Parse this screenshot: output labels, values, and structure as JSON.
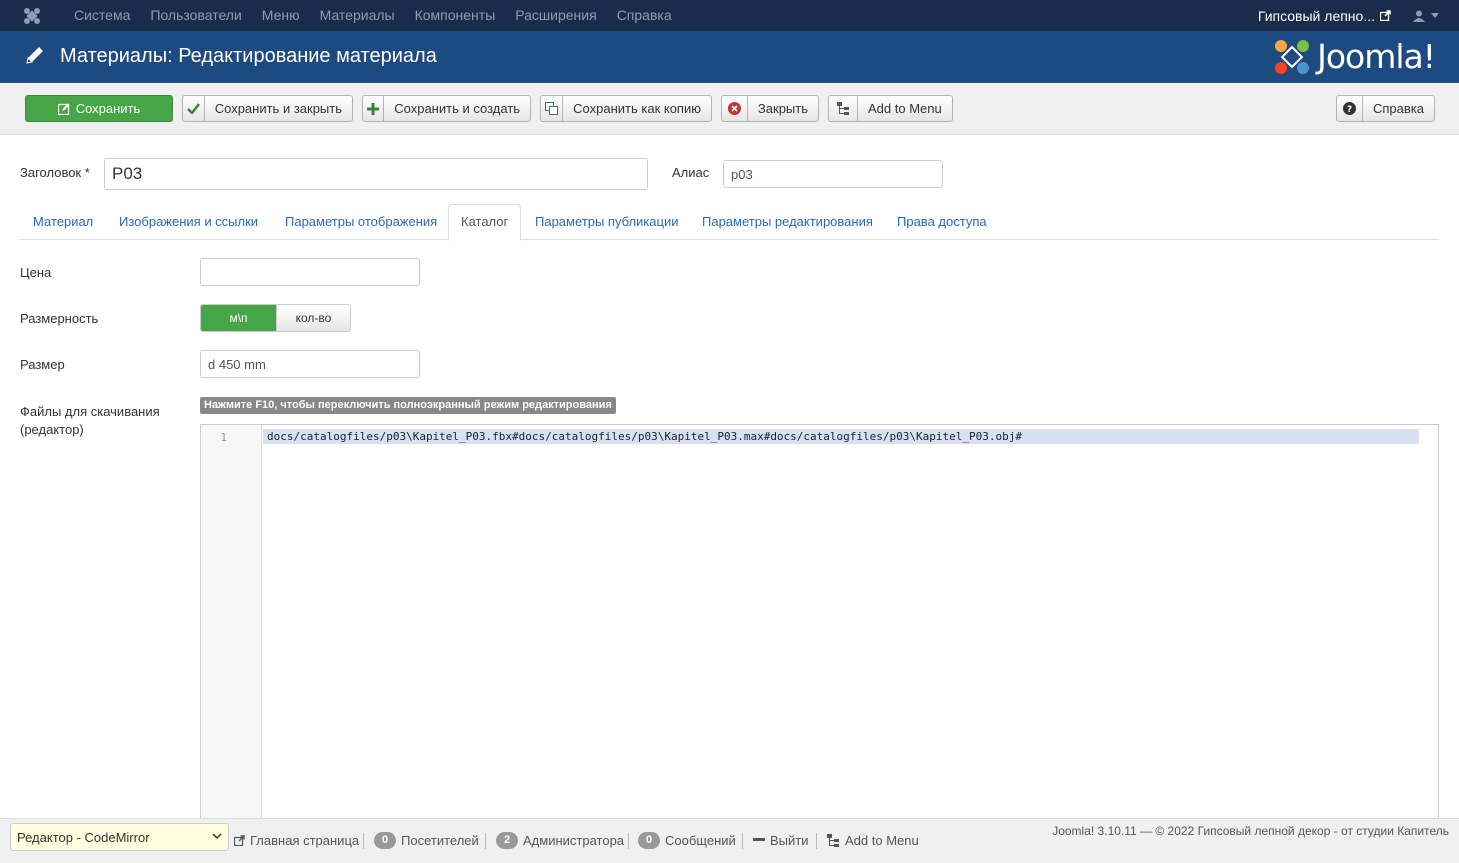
{
  "topnav": {
    "menu": [
      "Система",
      "Пользователи",
      "Меню",
      "Материалы",
      "Компоненты",
      "Расширения",
      "Справка"
    ],
    "site_name": "Гипсовый лепно..."
  },
  "header": {
    "title": "Материалы: Редактирование материала",
    "logo_text": "Joomla!"
  },
  "toolbar": {
    "save": "Сохранить",
    "save_close": "Сохранить и закрыть",
    "save_new": "Сохранить и создать",
    "save_copy": "Сохранить как копию",
    "close": "Закрыть",
    "add_to_menu": "Add to Menu",
    "help": "Справка"
  },
  "form": {
    "title_label": "Заголовок *",
    "title_value": "P03",
    "alias_label": "Алиас",
    "alias_value": "p03"
  },
  "tabs": [
    "Материал",
    "Изображения и ссылки",
    "Параметры отображения",
    "Каталог",
    "Параметры публикации",
    "Параметры редактирования",
    "Права доступа"
  ],
  "active_tab": "Каталог",
  "catalog": {
    "price_label": "Цена",
    "price_value": "",
    "dimension_label": "Размерность",
    "dimension_options": [
      "м\\п",
      "кол-во"
    ],
    "dimension_selected": "м\\п",
    "size_label": "Размер",
    "size_value": "d 450 mm",
    "files_label_line1": "Файлы для скачивания",
    "files_label_line2": "(редактор)",
    "editor_hint": "Нажмите F10, чтобы переключить полноэкранный режим редактирования",
    "editor_line_number": "1",
    "editor_content": "docs/catalogfiles/p03\\Kapitel_P03.fbx#docs/catalogfiles/p03\\Kapitel_P03.max#docs/catalogfiles/p03\\Kapitel_P03.obj#"
  },
  "statusbar": {
    "editor_select": "Редактор - CodeMirror",
    "home": "Главная страница",
    "visitors_count": "0",
    "visitors": "Посетителей",
    "admins_count": "2",
    "admins": "Администратора",
    "messages_count": "0",
    "messages": "Сообщений",
    "logout": "Выйти",
    "add_to_menu": "Add to Menu",
    "copyright": "Joomla! 3.10.11  —  © 2022 Гипсовый лепной декор - от студии Капитель"
  },
  "colors": {
    "topnav_bg": "#1a2c4c",
    "header_bg": "#1d4a80",
    "success_green": "#46a546",
    "link_blue": "#2a69b8"
  }
}
